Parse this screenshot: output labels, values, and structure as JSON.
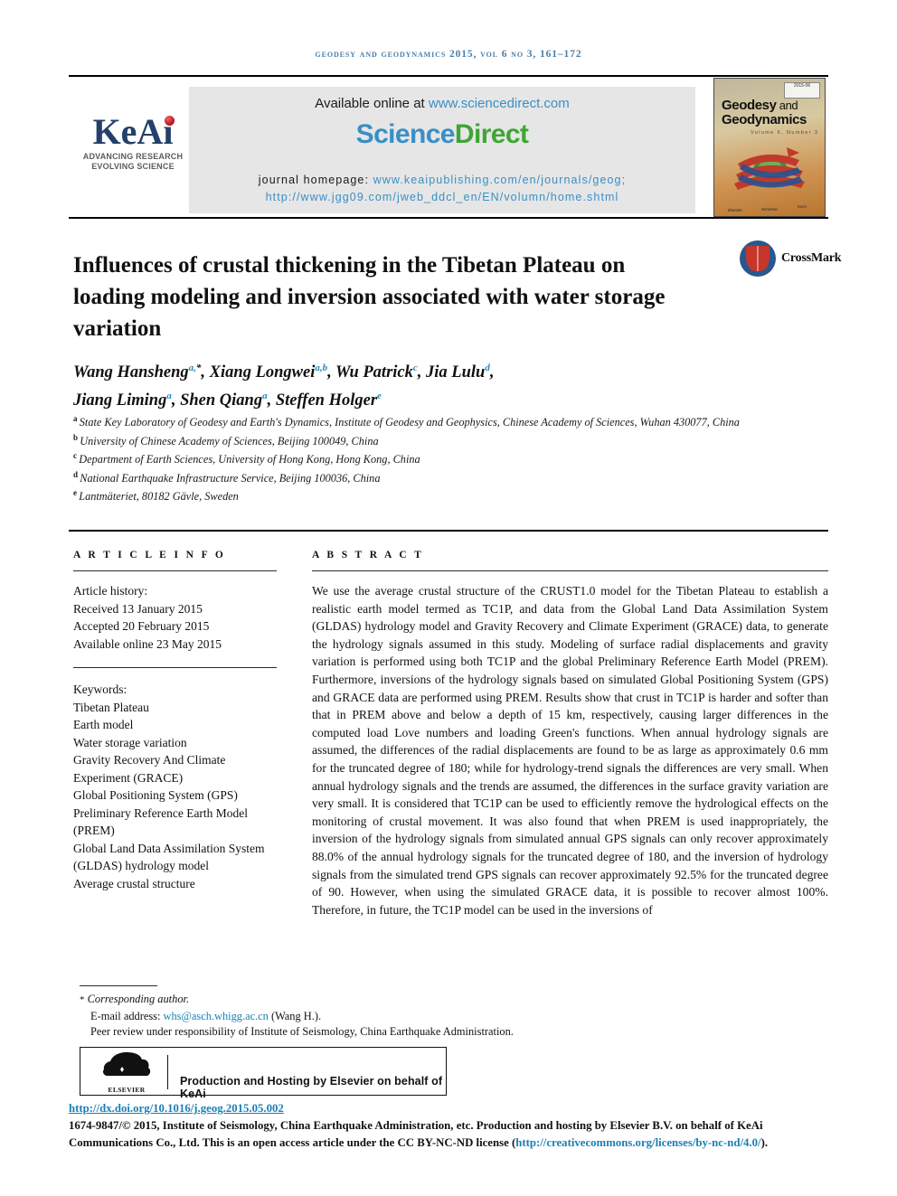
{
  "running_head": "Geodesy and Geodynamics 2015, vol 6 no 3, 161–172",
  "masthead": {
    "keai": {
      "word": "KeAi",
      "tagline_line1": "ADVANCING RESEARCH",
      "tagline_line2": "EVOLVING SCIENCE"
    },
    "available_prefix": "Available online at ",
    "available_url": "www.sciencedirect.com",
    "sciencedirect_part1": "Science",
    "sciencedirect_part2": "Direct",
    "homepage_label": "journal homepage: ",
    "homepage_url": "www.keaipublishing.com/en/journals/geog;",
    "homepage_url2": "http://www.jgg09.com/jweb_ddcl_en/EN/volumn/home.shtml",
    "cover": {
      "issue_badge": "2015-06",
      "title_line1_bold": "Geodesy",
      "title_line1_small": " and",
      "title_line2_bold": "Geodynamics",
      "subtitle": "Volume 6, Number 3",
      "footer_left": "Elsevier",
      "footer_mid": "SciVerse",
      "footer_right": "KeAi"
    }
  },
  "article": {
    "title": "Influences of crustal thickening in the Tibetan Plateau on loading modeling and inversion associated with water storage variation",
    "crossmark_label": "CrossMark",
    "authors_line1": [
      {
        "name": "Wang Hansheng",
        "sup": "a,",
        "star": "*",
        "sep": ", "
      },
      {
        "name": "Xiang Longwei",
        "sup": "a,b",
        "star": "",
        "sep": ", "
      },
      {
        "name": "Wu Patrick",
        "sup": "c",
        "star": "",
        "sep": ", "
      },
      {
        "name": "Jia Lulu",
        "sup": "d",
        "star": "",
        "sep": ","
      }
    ],
    "authors_line2": [
      {
        "name": "Jiang Liming",
        "sup": "a",
        "star": "",
        "sep": ", "
      },
      {
        "name": "Shen Qiang",
        "sup": "a",
        "star": "",
        "sep": ", "
      },
      {
        "name": "Steffen Holger",
        "sup": "e",
        "star": "",
        "sep": ""
      }
    ],
    "affiliations": [
      {
        "mark": "a",
        "text": "State Key Laboratory of Geodesy and Earth's Dynamics, Institute of Geodesy and Geophysics, Chinese Academy of Sciences, Wuhan 430077, China"
      },
      {
        "mark": "b",
        "text": "University of Chinese Academy of Sciences, Beijing 100049, China"
      },
      {
        "mark": "c",
        "text": "Department of Earth Sciences, University of Hong Kong, Hong Kong, China"
      },
      {
        "mark": "d",
        "text": "National Earthquake Infrastructure Service, Beijing 100036, China"
      },
      {
        "mark": "e",
        "text": "Lantmäteriet, 80182 Gävle, Sweden"
      }
    ]
  },
  "article_info": {
    "heading": "A R T I C L E   I N F O",
    "history_label": "Article history:",
    "history": [
      "Received 13 January 2015",
      "Accepted 20 February 2015",
      "Available online 23 May 2015"
    ],
    "keywords_label": "Keywords:",
    "keywords": [
      "Tibetan Plateau",
      "Earth model",
      "Water storage variation",
      "Gravity Recovery And Climate Experiment (GRACE)",
      "Global Positioning System (GPS)",
      "Preliminary Reference Earth Model (PREM)",
      "Global Land Data Assimilation System (GLDAS) hydrology model",
      "Average crustal structure"
    ]
  },
  "abstract": {
    "heading": "A B S T R A C T",
    "text": "We use the average crustal structure of the CRUST1.0 model for the Tibetan Plateau to establish a realistic earth model termed as TC1P, and data from the Global Land Data Assimilation System (GLDAS) hydrology model and Gravity Recovery and Climate Experiment (GRACE) data, to generate the hydrology signals assumed in this study. Modeling of surface radial displacements and gravity variation is performed using both TC1P and the global Preliminary Reference Earth Model (PREM). Furthermore, inversions of the hydrology signals based on simulated Global Positioning System (GPS) and GRACE data are performed using PREM. Results show that crust in TC1P is harder and softer than that in PREM above and below a depth of 15 km, respectively, causing larger differences in the computed load Love numbers and loading Green's functions. When annual hydrology signals are assumed, the differences of the radial displacements are found to be as large as approximately 0.6 mm for the truncated degree of 180; while for hydrology-trend signals the differences are very small. When annual hydrology signals and the trends are assumed, the differences in the surface gravity variation are very small. It is considered that TC1P can be used to efficiently remove the hydrological effects on the monitoring of crustal movement. It was also found that when PREM is used inappropriately, the inversion of the hydrology signals from simulated annual GPS signals can only recover approximately 88.0% of the annual hydrology signals for the truncated degree of 180, and the inversion of hydrology signals from the simulated trend GPS signals can recover approximately 92.5% for the truncated degree of 90. However, when using the simulated GRACE data, it is possible to recover almost 100%. Therefore, in future, the TC1P model can be used in the inversions of"
  },
  "footer": {
    "corresponding_star": "*",
    "corresponding_label": "Corresponding author.",
    "email_label": "E-mail address: ",
    "email": "whs@asch.whigg.ac.cn",
    "email_suffix": " (Wang H.).",
    "peer_review": "Peer review under responsibility of Institute of Seismology, China Earthquake Administration.",
    "host_box_text": "Production and Hosting by Elsevier on behalf of KeAi",
    "elsevier_word": "ELSEVIER",
    "doi": "http://dx.doi.org/10.1016/j.geog.2015.05.002",
    "copyright_part1": "1674-9847/© 2015, Institute of Seismology, China Earthquake Administration, etc. Production and hosting by Elsevier B.V. on behalf of KeAi Communications Co., Ltd. This is an open access article under the CC BY-NC-ND license (",
    "copyright_link": "http://creativecommons.org/licenses/by-nc-nd/4.0/",
    "copyright_part2": ")."
  },
  "colors": {
    "link_blue": "#1a7fb5",
    "sciencedirect_blue": "#3a8fc4",
    "sciencedirect_green": "#3fa535",
    "runhead_blue": "#4a7ea8",
    "keai_navy": "#23406a",
    "crossmark_blue": "#27598f",
    "crossmark_red": "#c8352b"
  }
}
